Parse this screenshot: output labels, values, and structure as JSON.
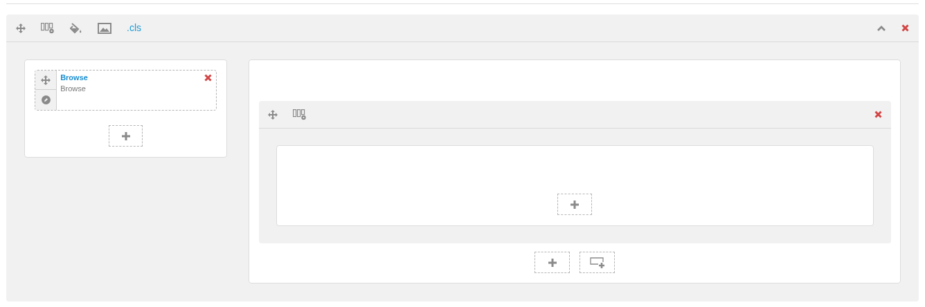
{
  "section_toolbar": {
    "class_link": ".cls"
  },
  "module": {
    "title": "Browse",
    "subtitle": "Browse"
  }
}
